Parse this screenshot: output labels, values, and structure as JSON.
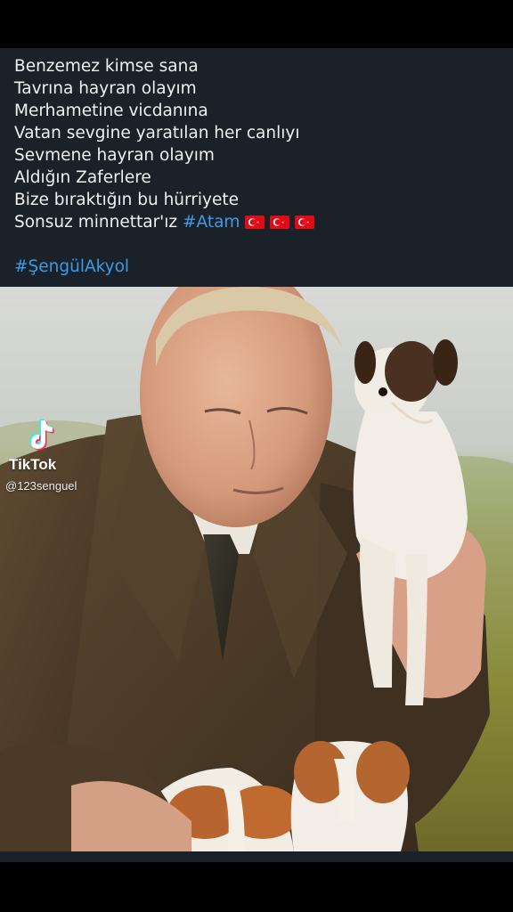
{
  "post": {
    "lines": [
      "Benzemez kimse sana",
      "Tavrına hayran olayım",
      "Merhametine vicdanına",
      "Vatan sevgine yaratılan her canlıyı",
      "Sevmene hayran olayım",
      "Aldığın Zaferlere",
      "Bize bıraktığın  bu hürriyete"
    ],
    "last_line_text": "Sonsuz minnettar'ız ",
    "hashtag_atam": "#Atam",
    "flag_emoji_icon": "turkish-flag-icon",
    "flag_count": 3,
    "hashtag_author": "#ŞengülAkyol"
  },
  "watermark": {
    "brand": "TikTok",
    "username": "@123senguel",
    "logo_icon": "tiktok-logo-icon"
  },
  "photo": {
    "icon": "portrait-with-puppies-image"
  },
  "colors": {
    "background": "#000000",
    "card": "#1b2128",
    "text": "#eef0f2",
    "hashtag": "#3b9be6",
    "flag_red": "#e30a17"
  }
}
